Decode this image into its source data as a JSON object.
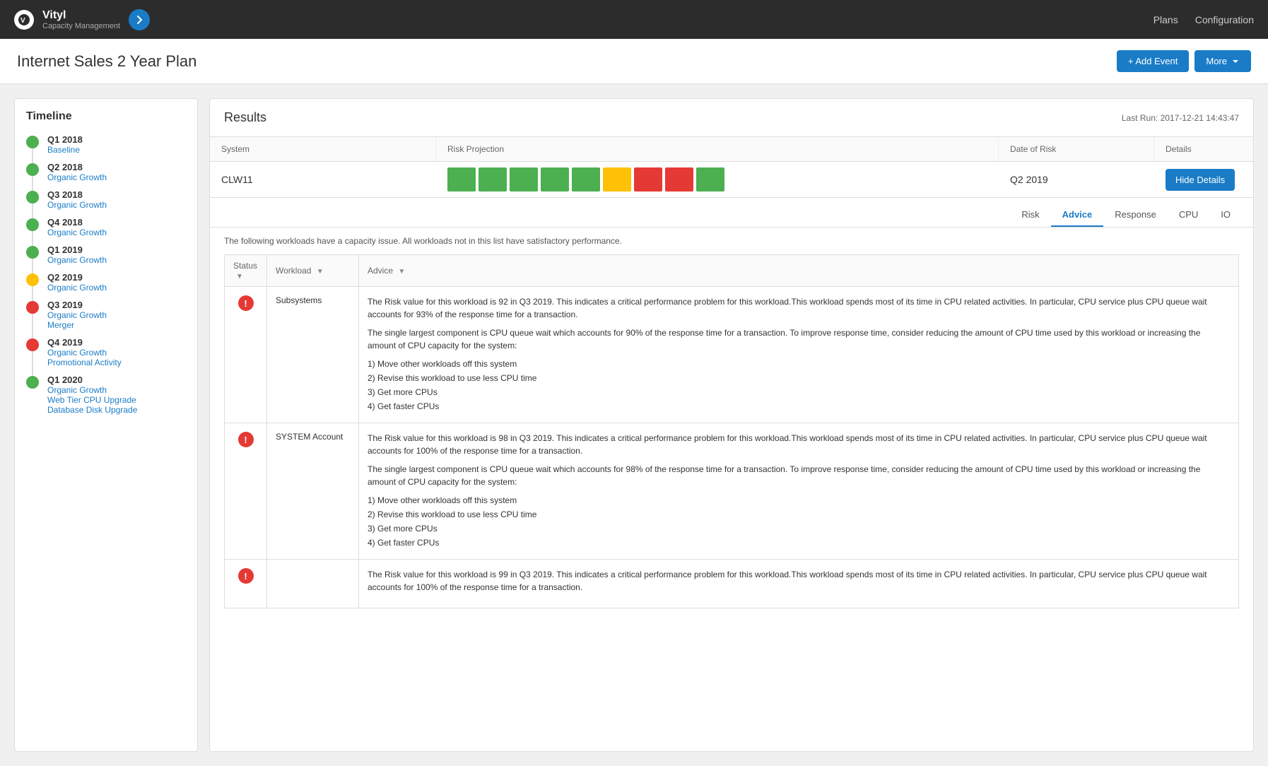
{
  "header": {
    "logo_title": "Vityl",
    "logo_subtitle": "Capacity Management",
    "nav_plans": "Plans",
    "nav_configuration": "Configuration"
  },
  "page": {
    "title": "Internet Sales 2 Year Plan",
    "btn_add_event": "+ Add Event",
    "btn_more": "More"
  },
  "timeline": {
    "title": "Timeline",
    "items": [
      {
        "period": "Q1 2018",
        "events": [
          "Baseline"
        ],
        "dot": "green"
      },
      {
        "period": "Q2 2018",
        "events": [
          "Organic Growth"
        ],
        "dot": "green"
      },
      {
        "period": "Q3 2018",
        "events": [
          "Organic Growth"
        ],
        "dot": "green"
      },
      {
        "period": "Q4 2018",
        "events": [
          "Organic Growth"
        ],
        "dot": "green"
      },
      {
        "period": "Q1 2019",
        "events": [
          "Organic Growth"
        ],
        "dot": "green"
      },
      {
        "period": "Q2 2019",
        "events": [
          "Organic Growth"
        ],
        "dot": "yellow"
      },
      {
        "period": "Q3 2019",
        "events": [
          "Organic Growth",
          "Merger"
        ],
        "dot": "red"
      },
      {
        "period": "Q4 2019",
        "events": [
          "Organic Growth",
          "Promotional Activity"
        ],
        "dot": "red"
      },
      {
        "period": "Q1 2020",
        "events": [
          "Organic Growth",
          "Web Tier CPU Upgrade",
          "Database Disk Upgrade"
        ],
        "dot": "green"
      }
    ]
  },
  "results": {
    "title": "Results",
    "last_run": "Last Run: 2017-12-21 14:43:47",
    "col_system": "System",
    "col_risk_projection": "Risk Projection",
    "col_date_of_risk": "Date of Risk",
    "col_details": "Details",
    "system_name": "CLW11",
    "date_of_risk": "Q2 2019",
    "btn_hide_details": "Hide Details",
    "tabs": [
      "Risk",
      "Advice",
      "Response",
      "CPU",
      "IO"
    ],
    "active_tab": "Advice",
    "advisory_intro": "The following workloads have a capacity issue. All workloads not in this list have satisfactory performance.",
    "col_status": "Status",
    "col_workload": "Workload",
    "col_advice": "Advice",
    "workloads": [
      {
        "status": "warning",
        "name": "Subsystems",
        "advice_paras": [
          "The Risk value for this workload is 92 in Q3 2019. This indicates a critical performance problem for this workload.This workload spends most of its time in CPU related activities. In particular, CPU service plus CPU queue wait accounts for 93% of the response time for a transaction.",
          "The single largest component is CPU queue wait which accounts for 90% of the response time for a transaction. To improve response time, consider reducing the amount of CPU time used by this workload or increasing the amount of CPU capacity for the system:"
        ],
        "advice_list": [
          "1) Move other workloads off this system",
          "2) Revise this workload to use less CPU time",
          "3) Get more CPUs",
          "4) Get faster CPUs"
        ]
      },
      {
        "status": "warning",
        "name": "SYSTEM Account",
        "advice_paras": [
          "The Risk value for this workload is 98 in Q3 2019. This indicates a critical performance problem for this workload.This workload spends most of its time in CPU related activities. In particular, CPU service plus CPU queue wait accounts for 100% of the response time for a transaction.",
          "The single largest component is CPU queue wait which accounts for 98% of the response time for a transaction. To improve response time, consider reducing the amount of CPU time used by this workload or increasing the amount of CPU capacity for the system:"
        ],
        "advice_list": [
          "1) Move other workloads off this system",
          "2) Revise this workload to use less CPU time",
          "3) Get more CPUs",
          "4) Get faster CPUs"
        ]
      },
      {
        "status": "warning",
        "name": "",
        "advice_paras": [
          "The Risk value for this workload is 99 in Q3 2019. This indicates a critical performance problem for this workload.This workload spends most of its time in CPU related activities. In particular, CPU service plus CPU queue wait accounts for 100% of the response time for a transaction."
        ],
        "advice_list": []
      }
    ],
    "risk_bars": [
      {
        "color": "green"
      },
      {
        "color": "green"
      },
      {
        "color": "green"
      },
      {
        "color": "green"
      },
      {
        "color": "green"
      },
      {
        "color": "yellow"
      },
      {
        "color": "red"
      },
      {
        "color": "red"
      },
      {
        "color": "green"
      }
    ]
  }
}
